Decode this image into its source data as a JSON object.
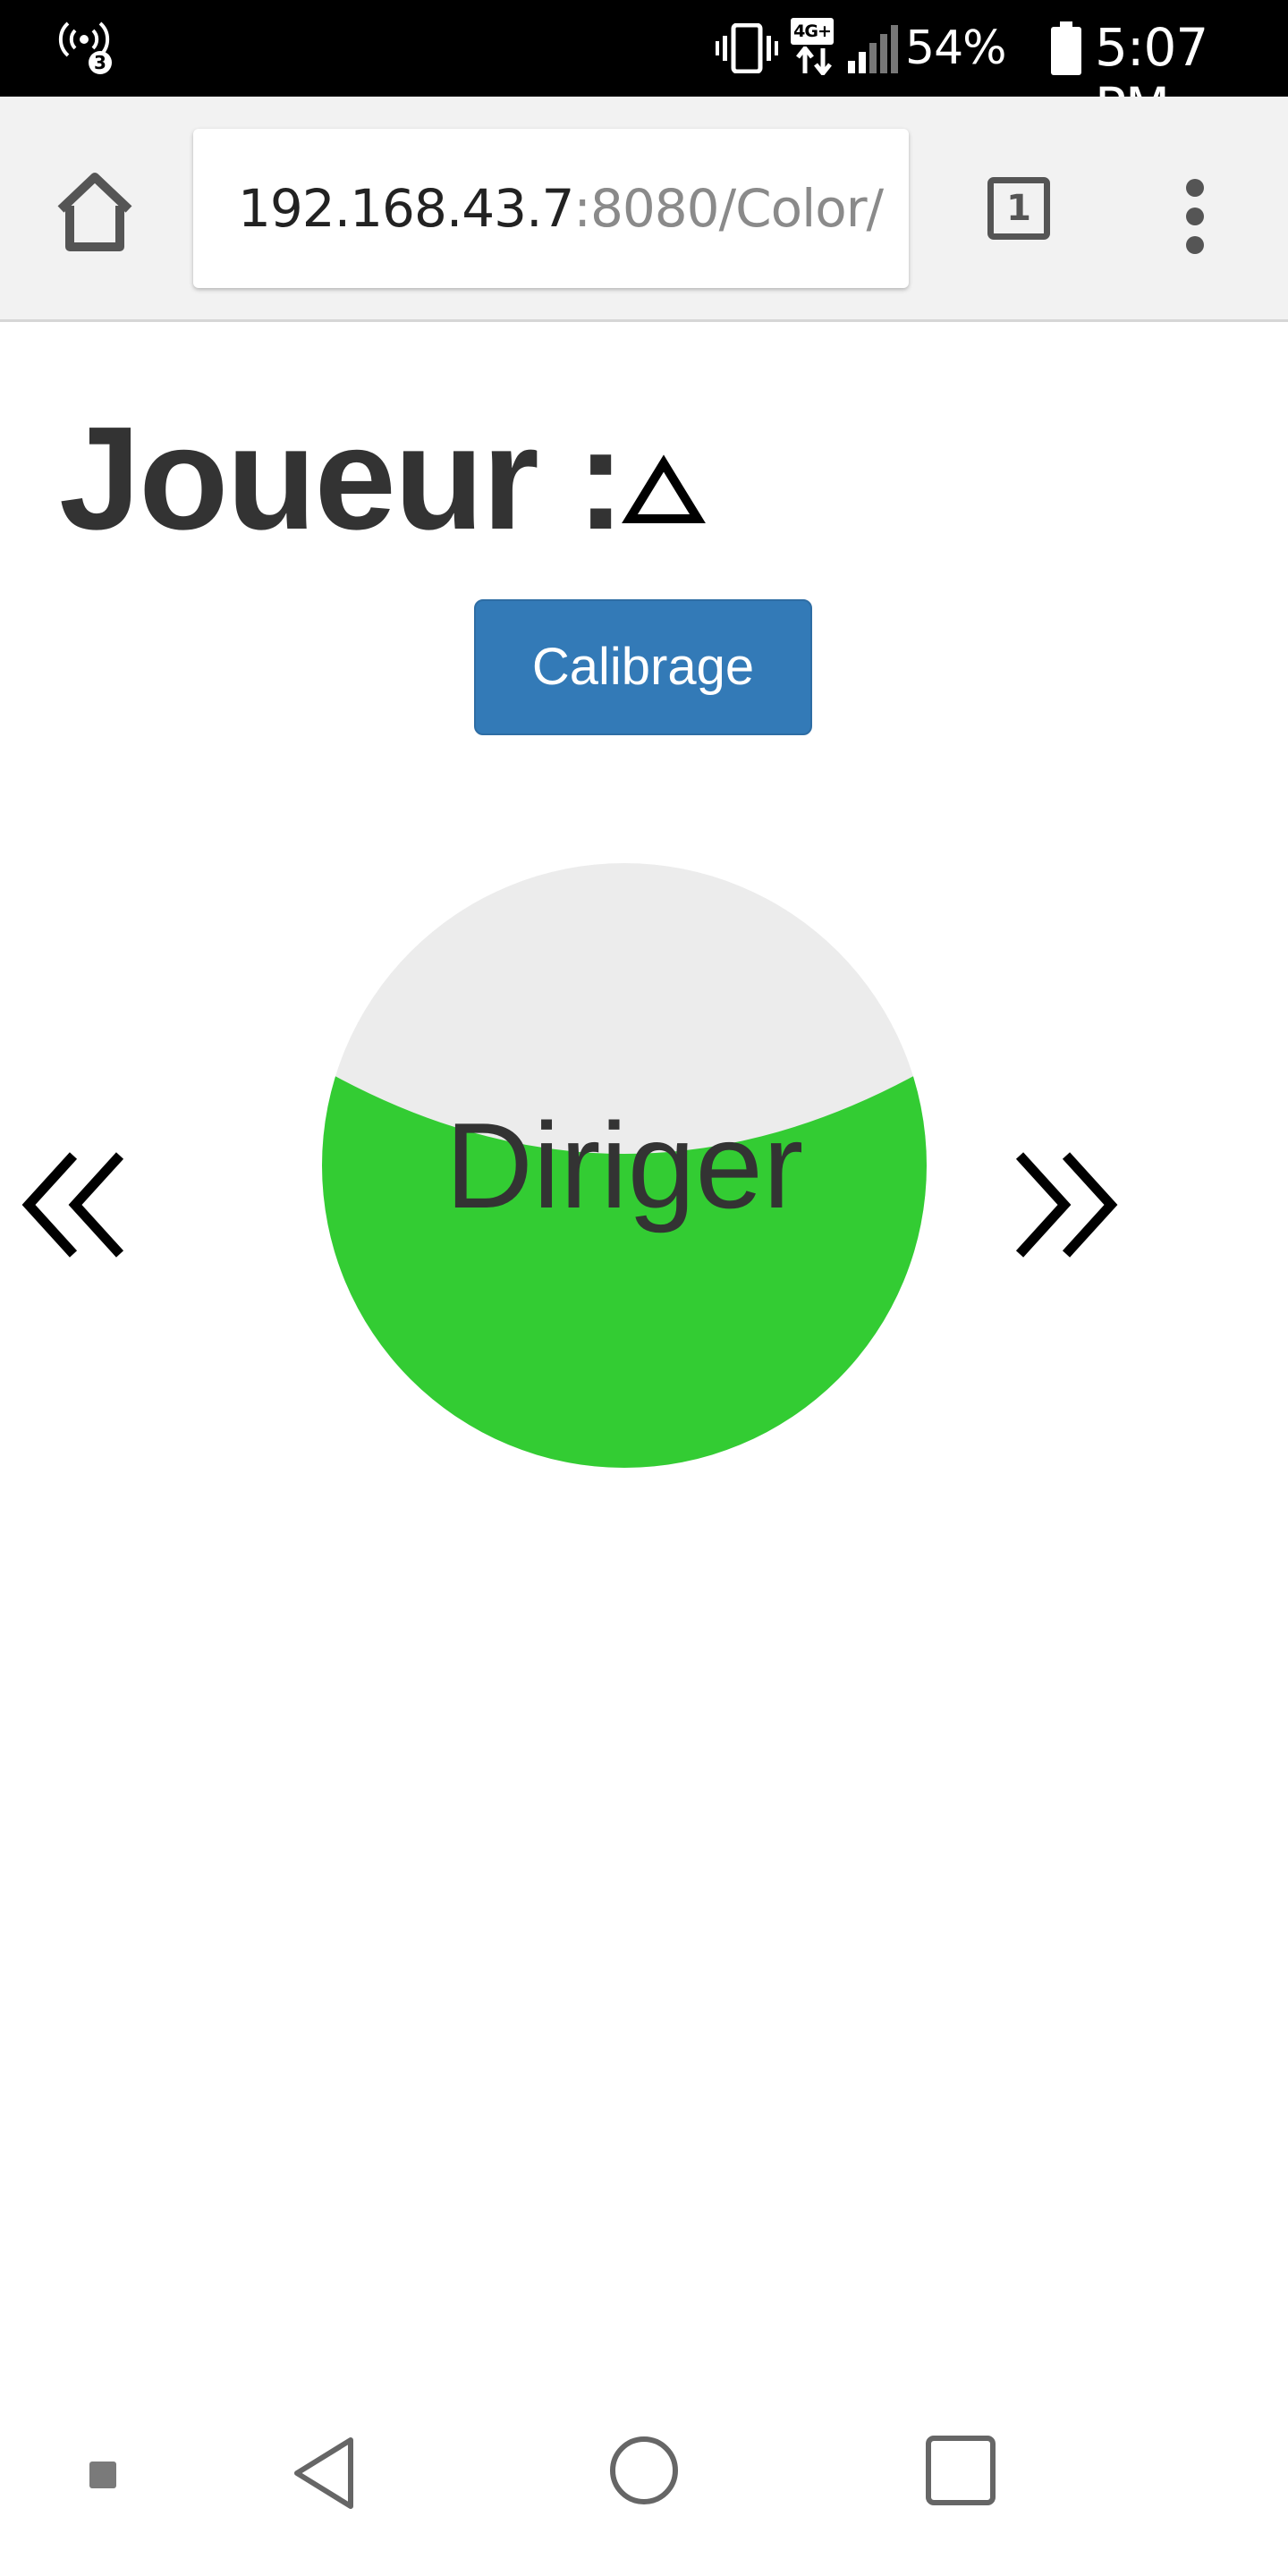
{
  "status_bar": {
    "hotspot_icon": "wifi-hotspot-icon",
    "hotspot_count": "3",
    "network_type": "4G+",
    "battery_percent": "54%",
    "time": "5:07 PM"
  },
  "browser": {
    "url_host": "192.168.43.7",
    "url_path": ":8080/Color/",
    "tab_count": "1"
  },
  "page": {
    "title": "Joueur :",
    "player_symbol": "triangle-icon",
    "calibrate_label": "Calibrage",
    "joystick_label": "Diriger",
    "joystick_fill_color": "#33cc33",
    "joystick_empty_color": "#ececec",
    "button_color": "#337ab7",
    "left_arrow_icon": "double-chevron-left-icon",
    "right_arrow_icon": "double-chevron-right-icon"
  }
}
